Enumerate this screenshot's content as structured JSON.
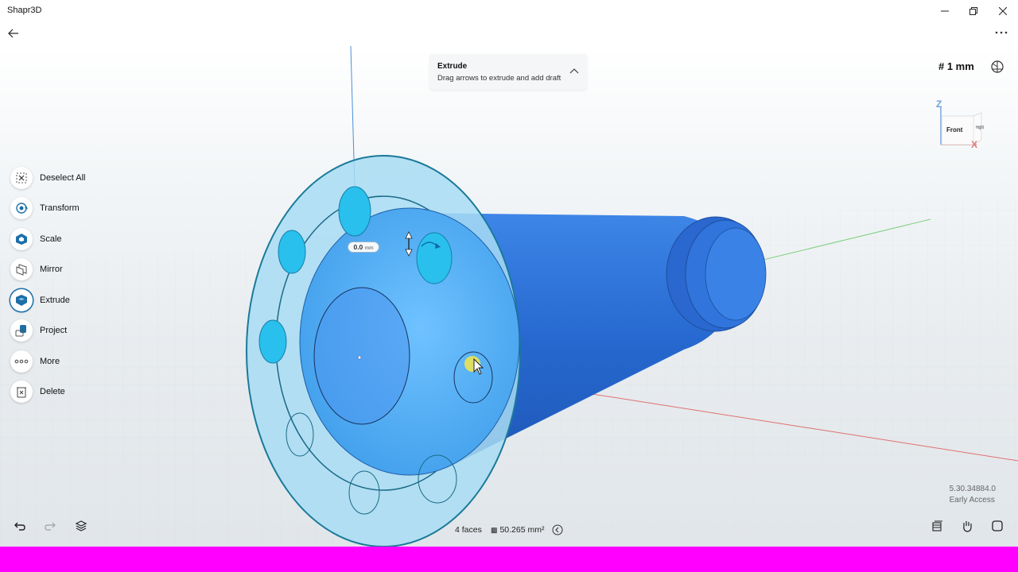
{
  "window": {
    "title": "Shapr3D",
    "controls": [
      "minimize",
      "restore",
      "close"
    ]
  },
  "topbar": {
    "back_icon": "back-arrow-icon",
    "more_icon": "more-horizontal-icon"
  },
  "hint": {
    "title": "Extrude",
    "subtitle": "Drag arrows to extrude and add draft",
    "collapse_icon": "chevron-up-icon"
  },
  "grid": {
    "label": "# 1 mm"
  },
  "viewcube": {
    "front": "Front",
    "right": "Right",
    "axis_z": "Z",
    "axis_x": "X"
  },
  "tools": [
    {
      "label": "Deselect All",
      "icon": "deselect-all-icon"
    },
    {
      "label": "Transform",
      "icon": "transform-icon"
    },
    {
      "label": "Scale",
      "icon": "scale-icon"
    },
    {
      "label": "Mirror",
      "icon": "mirror-icon"
    },
    {
      "label": "Extrude",
      "icon": "extrude-icon",
      "active": true
    },
    {
      "label": "Project",
      "icon": "project-icon"
    },
    {
      "label": "More",
      "icon": "more-dots-icon"
    },
    {
      "label": "Delete",
      "icon": "delete-icon"
    }
  ],
  "dimension": {
    "value": "0.0",
    "unit": "mm"
  },
  "status": {
    "faces": "4 faces",
    "area": "50.265 mm²"
  },
  "version": {
    "number": "5.30.34884.0",
    "channel": "Early Access"
  },
  "colors": {
    "accent": "#1d6fa8",
    "selection_fill": "#5ab4f0",
    "body_blue": "#2a6fd6",
    "flange_fill": "#a6dcf2",
    "overlay_bar": "#ff00ff"
  }
}
